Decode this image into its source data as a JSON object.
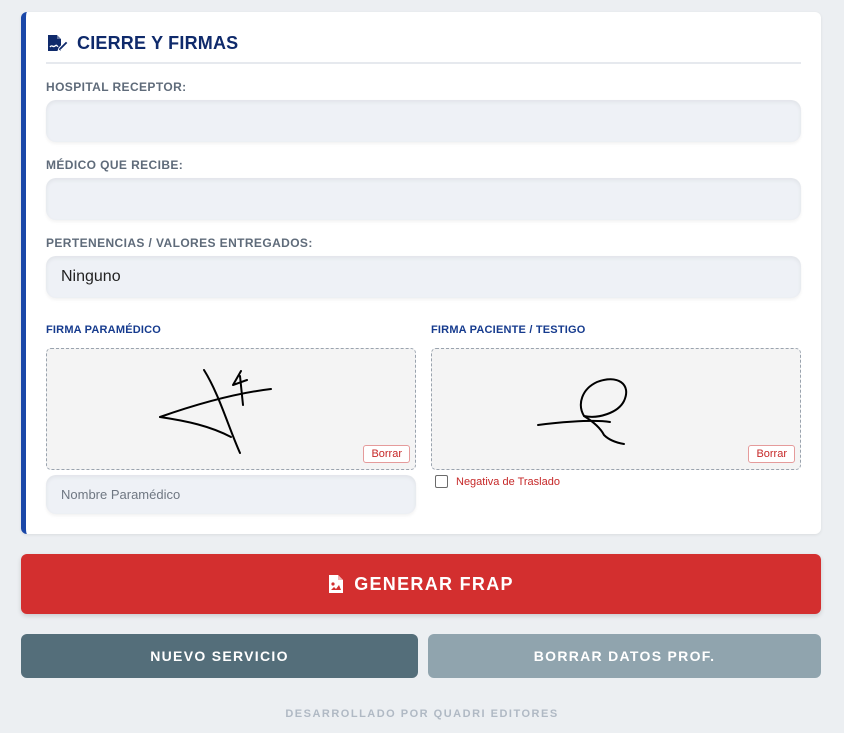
{
  "section": {
    "title": "CIERRE Y FIRMAS"
  },
  "fields": {
    "hospital_label": "HOSPITAL RECEPTOR:",
    "hospital_value": "",
    "doctor_label": "MÉDICO QUE RECIBE:",
    "doctor_value": "",
    "belongings_label": "PERTENENCIAS / VALORES ENTREGADOS:",
    "belongings_value": "Ninguno"
  },
  "signatures": {
    "paramedic_label": "FIRMA PARAMÉDICO",
    "patient_label": "FIRMA PACIENTE / TESTIGO",
    "clear_label": "Borrar",
    "paramedic_name_placeholder": "Nombre Paramédico",
    "refusal_label": "Negativa de Traslado",
    "refusal_checked": false
  },
  "actions": {
    "generate_label": "GENERAR FRAP",
    "new_service_label": "NUEVO SERVICIO",
    "clear_prof_label": "BORRAR DATOS PROF."
  },
  "colors": {
    "accent_blue": "#1a47a8",
    "primary_red": "#d32f2f",
    "secondary_slate": "#546e7a",
    "muted_slate": "#90a4ae"
  },
  "footer": {
    "text": "DESARROLLADO POR QUADRI EDITORES"
  }
}
